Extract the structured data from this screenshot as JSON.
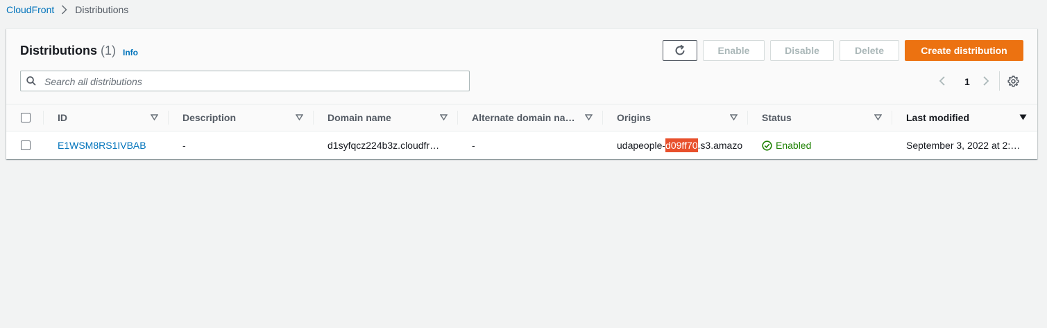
{
  "breadcrumb": {
    "root": "CloudFront",
    "current": "Distributions"
  },
  "header": {
    "title": "Distributions",
    "count": "(1)",
    "info": "Info"
  },
  "actions": {
    "enable": "Enable",
    "disable": "Disable",
    "delete": "Delete",
    "create": "Create distribution"
  },
  "search": {
    "placeholder": "Search all distributions",
    "value": ""
  },
  "pagination": {
    "current_page": "1"
  },
  "columns": [
    "ID",
    "Description",
    "Domain name",
    "Alternate domain na…",
    "Origins",
    "Status",
    "Last modified"
  ],
  "rows": [
    {
      "id": "E1WSM8RS1IVBAB",
      "description": "-",
      "domain": "d1syfqcz224b3z.cloudfr…",
      "alternate": "-",
      "origin_prefix": "udapeople-",
      "origin_redacted": "d09ff70",
      "origin_suffix": ".s3.amazo",
      "status": "Enabled",
      "last_modified": "September 3, 2022 at 2:…"
    }
  ],
  "colors": {
    "primary": "#ec7211",
    "link": "#0073bb",
    "success": "#1d8102",
    "redaction": "#e8502c"
  }
}
